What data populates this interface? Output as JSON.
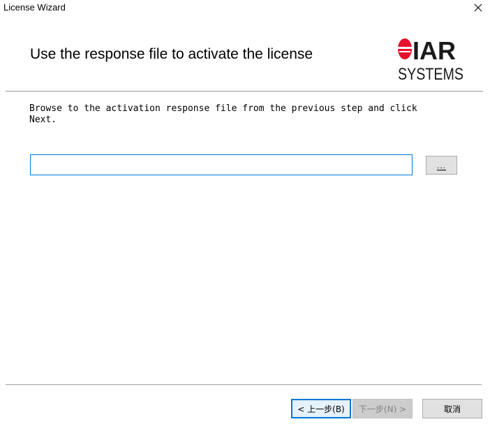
{
  "window": {
    "title": "License Wizard",
    "close_glyph": "✕"
  },
  "header": {
    "title": "Use the response file to activate the license",
    "logo": {
      "mark": "IAR",
      "sub": "SYSTEMS",
      "brand_color": "#e8112d"
    }
  },
  "body": {
    "instruction_line1": "Browse to the activation response file from the previous step and click",
    "instruction_line2": "Next.",
    "path_input": {
      "value": "",
      "placeholder": ""
    },
    "browse_label": "..."
  },
  "footer": {
    "back_label": "< 上一步(B)",
    "next_label": "下一步(N) >",
    "cancel_label": "取消",
    "next_enabled": false
  },
  "colors": {
    "focus_border": "#0078d7",
    "button_face": "#e1e1e1",
    "disabled_text": "#838383"
  }
}
